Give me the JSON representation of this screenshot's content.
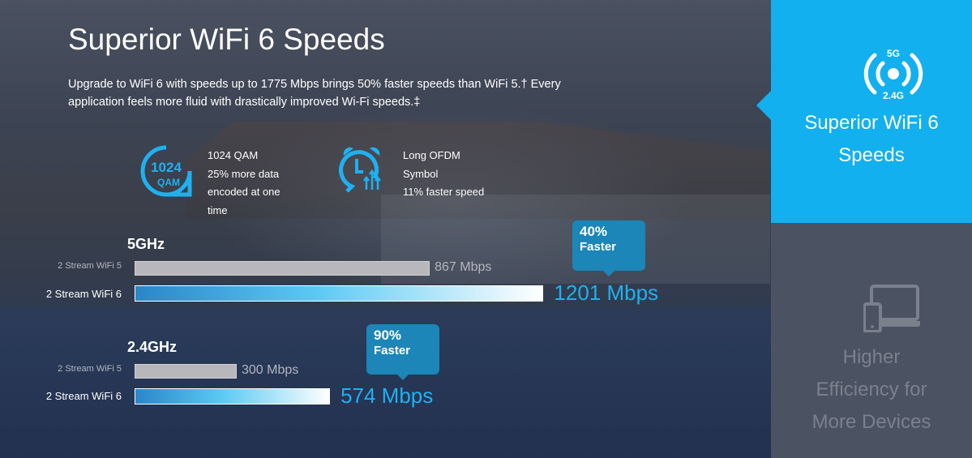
{
  "header": {
    "title": "Superior WiFi 6 Speeds",
    "description": "Upgrade to WiFi 6 with speeds up to 1775 Mbps brings 50% faster speeds than WiFi 5.† Every application feels more fluid with drastically improved Wi-Fi speeds.‡"
  },
  "features": [
    {
      "icon": "1024-qam-icon",
      "icon_text": [
        "1024",
        "QAM"
      ],
      "title": "1024 QAM",
      "lines": [
        "25% more data",
        "encoded at one",
        "time"
      ]
    },
    {
      "icon": "alarm-clock-speed-icon",
      "title_lines": [
        "Long OFDM",
        "Symbol"
      ],
      "lines": [
        "11% faster speed"
      ]
    }
  ],
  "bands": [
    {
      "name": "5GHz",
      "wifi5_label": "2 Stream WiFi 5",
      "wifi5_mbps": 867,
      "wifi5_value": "867 Mbps",
      "wifi6_label": "2 Stream WiFi 6",
      "wifi6_mbps": 1201,
      "wifi6_value": "1201 Mbps",
      "callout_percent": "40%",
      "callout_text": "Faster"
    },
    {
      "name": "2.4GHz",
      "wifi5_label": "2 Stream WiFi 5",
      "wifi5_mbps": 300,
      "wifi5_value": "300 Mbps",
      "wifi6_label": "2 Stream WiFi 6",
      "wifi6_mbps": 574,
      "wifi6_value": "574 Mbps",
      "callout_percent": "90%",
      "callout_text": "Faster"
    }
  ],
  "sidebar": {
    "items": [
      {
        "label_lines": [
          "Superior WiFi 6",
          "Speeds"
        ],
        "icon": "wifi-dual-band-icon",
        "icon_text": [
          "5G",
          "2.4G"
        ],
        "active": true
      },
      {
        "label_lines": [
          "Higher",
          "Efficiency for",
          "More Devices"
        ],
        "icon": "devices-icon",
        "active": false
      }
    ]
  },
  "colors": {
    "accent": "#12b0ee",
    "sidebar_inactive": "#4b5262",
    "callout": "#1b86b7",
    "value_blue": "#1eb1f2"
  }
}
